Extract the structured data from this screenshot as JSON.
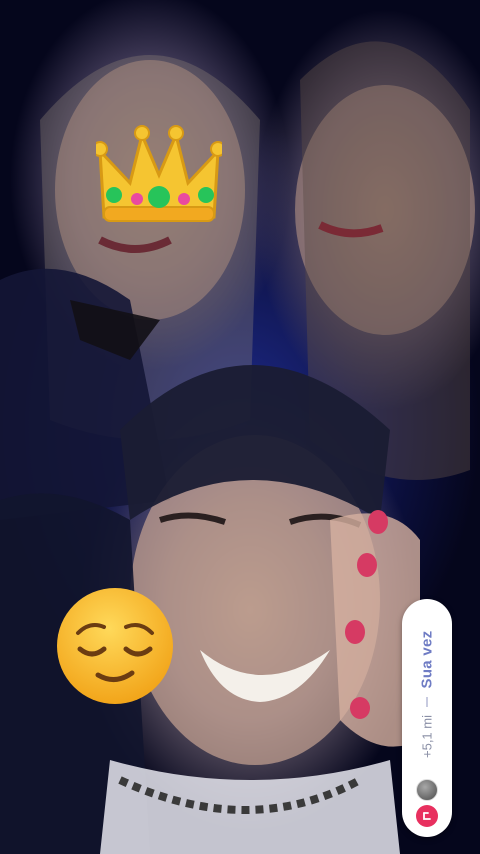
{
  "story": {
    "stickers": [
      {
        "name": "crown-emoji"
      },
      {
        "name": "relieved-face-emoji"
      }
    ],
    "reply_panel": {
      "title": "Sua vez",
      "reach_count": "+5,1 mi",
      "icons": [
        "avatar-icon",
        "share-arrow-icon"
      ],
      "accent_color": "#e8305f",
      "title_color": "#6f7cc4"
    }
  }
}
